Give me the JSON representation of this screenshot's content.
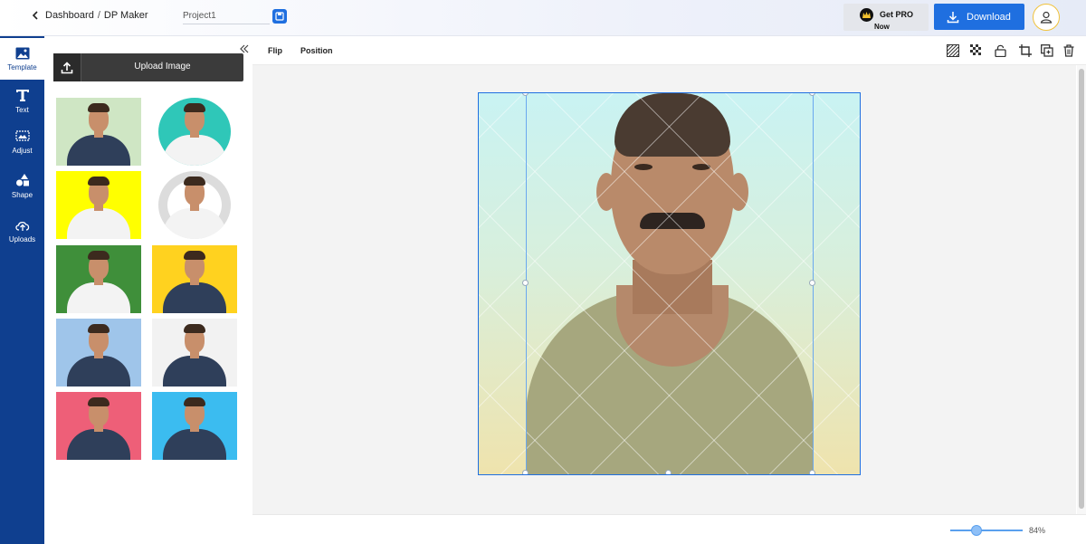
{
  "header": {
    "breadcrumb_parent": "Dashboard",
    "breadcrumb_sep": "/",
    "breadcrumb_current": "DP Maker",
    "project_name": "Project1",
    "get_pro_line1": "Get PRO",
    "get_pro_line2": "Now",
    "download_label": "Download"
  },
  "rail": {
    "items": [
      {
        "label": "Template",
        "icon": "image-icon",
        "active": true
      },
      {
        "label": "Text",
        "icon": "text-icon"
      },
      {
        "label": "Adjust",
        "icon": "adjust-icon"
      },
      {
        "label": "Shape",
        "icon": "shape-icon"
      },
      {
        "label": "Uploads",
        "icon": "cloud-upload-icon"
      }
    ]
  },
  "panel": {
    "upload_label": "Upload Image",
    "templates": [
      {
        "bg": "#cfe6c4",
        "shirt": "dark"
      },
      {
        "bg": "#2fc7b8",
        "shirt": "white",
        "shape": "circle"
      },
      {
        "bg": "#ffff00",
        "shirt": "white"
      },
      {
        "bg": "#f4f4f4",
        "shirt": "white",
        "shape": "ring"
      },
      {
        "bg": "#3f8f3a",
        "shirt": "white"
      },
      {
        "bg": "#ffd21f",
        "shirt": "dark"
      },
      {
        "bg": "#9fc5ea",
        "shirt": "dark"
      },
      {
        "bg": "#f2f2f2",
        "shirt": "dark"
      },
      {
        "bg": "#ee5f78",
        "shirt": "dark"
      },
      {
        "bg": "#3bbcf0",
        "shirt": "dark"
      }
    ]
  },
  "toolbar": {
    "flip_label": "Flip",
    "position_label": "Position"
  },
  "zoom": {
    "value_label": "84%",
    "level": 0.84
  },
  "colors": {
    "accent": "#1f6fe0",
    "rail": "#0f3f8f"
  }
}
